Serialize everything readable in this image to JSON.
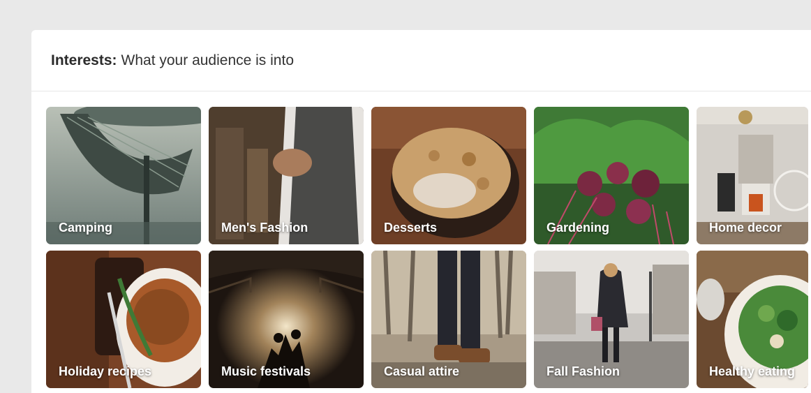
{
  "header": {
    "title_strong": "Interests:",
    "title_rest": "What your audience is into"
  },
  "interests": [
    {
      "label": "Camping",
      "icon": "camping-photo"
    },
    {
      "label": "Men's Fashion",
      "icon": "mens-fashion-photo"
    },
    {
      "label": "Desserts",
      "icon": "desserts-photo"
    },
    {
      "label": "Gardening",
      "icon": "gardening-photo"
    },
    {
      "label": "Home decor",
      "icon": "home-decor-photo"
    },
    {
      "label": "Holiday recipes",
      "icon": "holiday-recipes-photo"
    },
    {
      "label": "Music festivals",
      "icon": "music-festivals-photo"
    },
    {
      "label": "Casual attire",
      "icon": "casual-attire-photo"
    },
    {
      "label": "Fall Fashion",
      "icon": "fall-fashion-photo"
    },
    {
      "label": "Healthy eating",
      "icon": "healthy-eating-photo"
    }
  ]
}
